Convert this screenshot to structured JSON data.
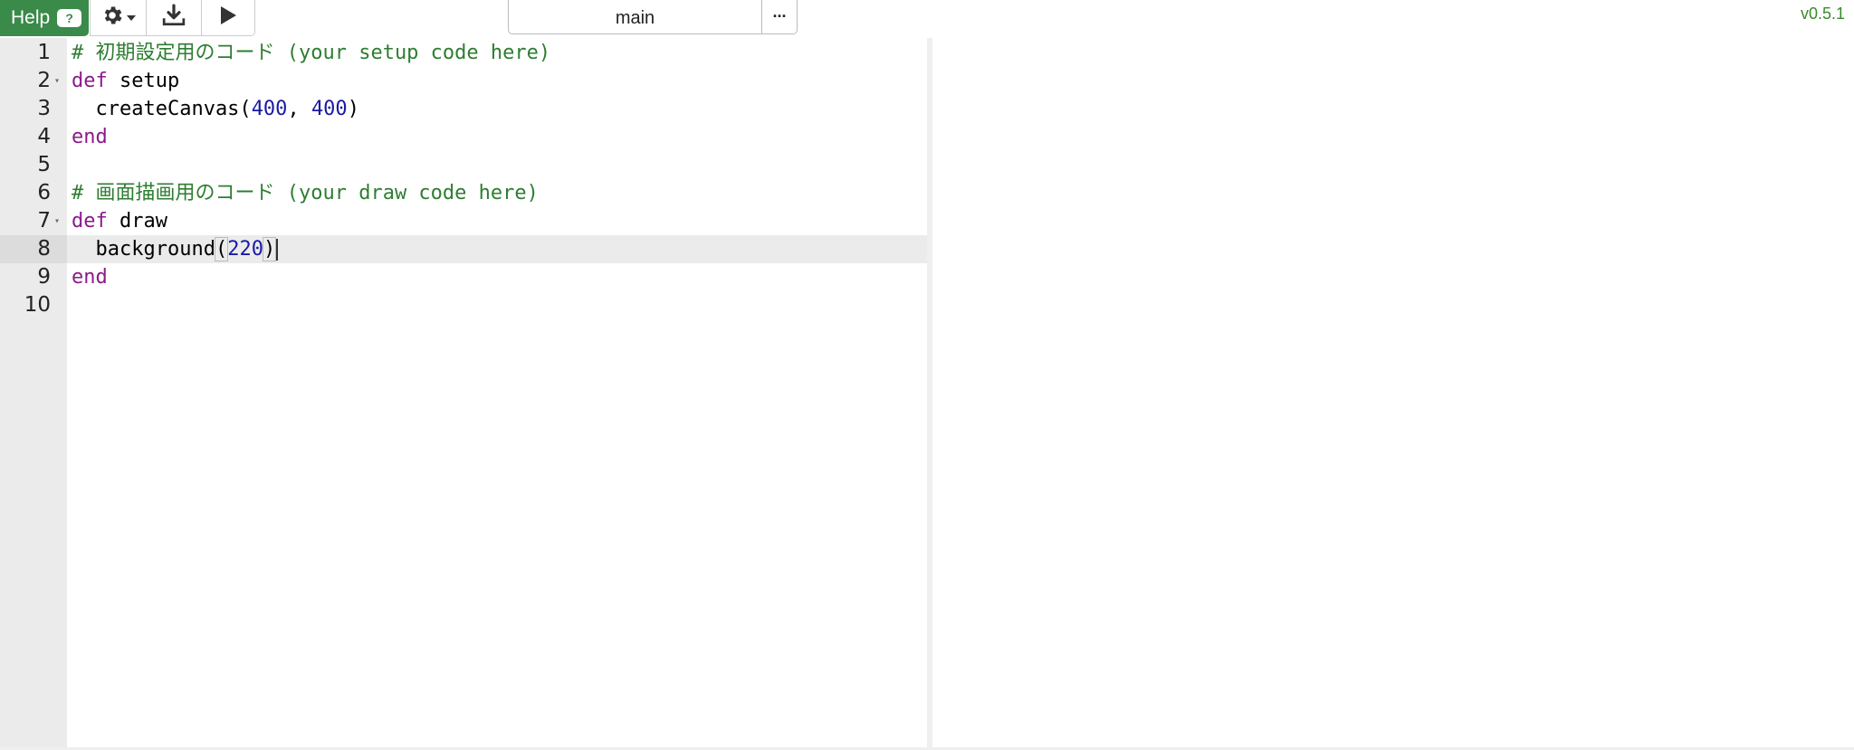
{
  "toolbar": {
    "help_label": "Help",
    "help_badge": "?",
    "settings_icon": "gear-icon",
    "download_icon": "download-icon",
    "run_icon": "play-icon",
    "file_tab": "main",
    "more_label": "···",
    "version": "v0.5.1"
  },
  "colors": {
    "help_bg": "#3a8a4a",
    "comment": "#2e7d32",
    "keyword": "#8b1a8b",
    "number": "#1a1aa6",
    "version": "#3a8a2a"
  },
  "editor": {
    "active_line": 8,
    "lines": [
      {
        "num": "1",
        "tokens": [
          {
            "t": "# 初期設定用のコード (your setup code here)",
            "c": "comment"
          }
        ]
      },
      {
        "num": "2",
        "fold": true,
        "tokens": [
          {
            "t": "def",
            "c": "keyword"
          },
          {
            "t": " setup",
            "c": ""
          }
        ]
      },
      {
        "num": "3",
        "tokens": [
          {
            "t": "  createCanvas(",
            "c": ""
          },
          {
            "t": "400",
            "c": "number"
          },
          {
            "t": ", ",
            "c": ""
          },
          {
            "t": "400",
            "c": "number"
          },
          {
            "t": ")",
            "c": ""
          }
        ]
      },
      {
        "num": "4",
        "tokens": [
          {
            "t": "end",
            "c": "keyword"
          }
        ]
      },
      {
        "num": "5",
        "tokens": []
      },
      {
        "num": "6",
        "tokens": [
          {
            "t": "# 画面描画用のコード (your draw code here)",
            "c": "comment"
          }
        ]
      },
      {
        "num": "7",
        "fold": true,
        "tokens": [
          {
            "t": "def",
            "c": "keyword"
          },
          {
            "t": " draw",
            "c": ""
          }
        ]
      },
      {
        "num": "8",
        "tokens": [
          {
            "t": "  background",
            "c": ""
          },
          {
            "t": "(",
            "c": "bracket"
          },
          {
            "t": "220",
            "c": "number"
          },
          {
            "t": ")",
            "c": "bracket"
          }
        ],
        "cursor": true
      },
      {
        "num": "9",
        "tokens": [
          {
            "t": "end",
            "c": "keyword"
          }
        ]
      },
      {
        "num": "10",
        "tokens": []
      }
    ]
  }
}
